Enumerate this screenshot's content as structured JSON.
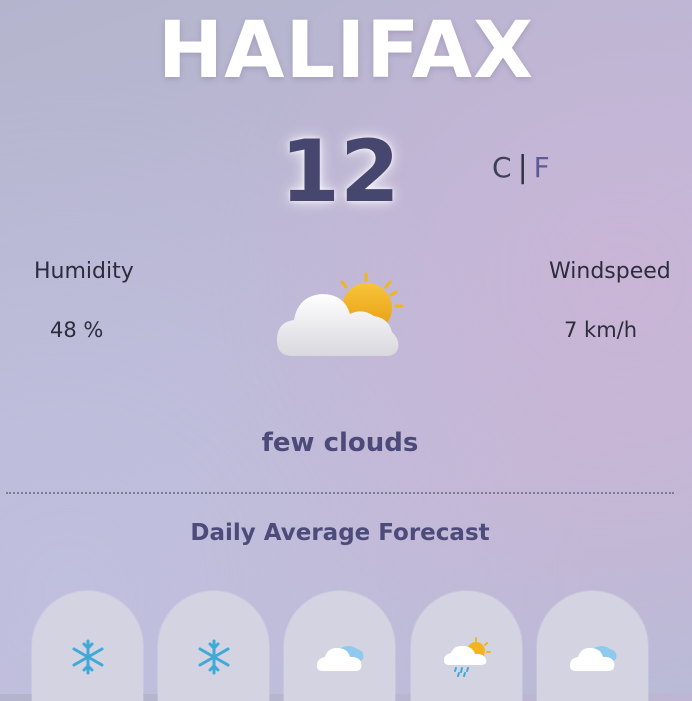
{
  "city": "HALIFAX",
  "current": {
    "temperature": "12",
    "unit_c": "C",
    "unit_separator": "|",
    "unit_f": "F",
    "condition_icon": "few-clouds-icon",
    "description": "few clouds"
  },
  "stats": {
    "humidity_label": "Humidity",
    "humidity_value": "48 %",
    "windspeed_label": "Windspeed",
    "windspeed_value": "7 km/h"
  },
  "forecast": {
    "title": "Daily Average Forecast",
    "days": [
      {
        "icon": "snowflake-icon"
      },
      {
        "icon": "snowflake-icon"
      },
      {
        "icon": "cloud-icon"
      },
      {
        "icon": "rain-sun-cloud-icon"
      },
      {
        "icon": "cloud-icon"
      }
    ]
  },
  "colors": {
    "temperature": "#47466f",
    "accent": "#4b4a78",
    "card": "#d3d3e2",
    "snow": "#3fa9d8",
    "sun": "#f2b51e"
  }
}
